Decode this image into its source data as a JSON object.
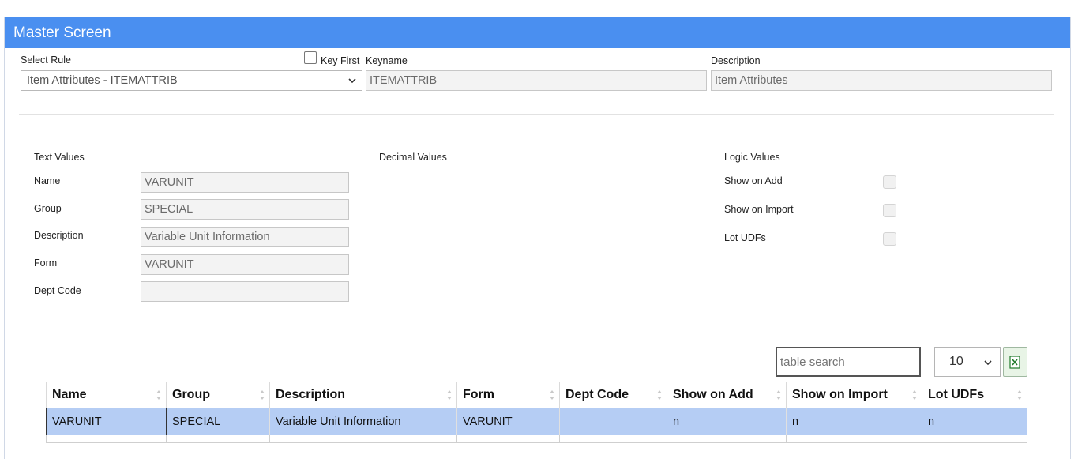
{
  "panel": {
    "title": "Master Screen"
  },
  "header": {
    "select_rule_label": "Select Rule",
    "select_rule_value": "Item Attributes - ITEMATTRIB",
    "key_first_label": "Key First",
    "keyname_label": "Keyname",
    "keyname_value": "ITEMATTRIB",
    "description_label": "Description",
    "description_value": "Item Attributes"
  },
  "text_values": {
    "heading": "Text Values",
    "fields": [
      {
        "label": "Name",
        "value": "VARUNIT"
      },
      {
        "label": "Group",
        "value": "SPECIAL"
      },
      {
        "label": "Description",
        "value": "Variable Unit Information"
      },
      {
        "label": "Form",
        "value": "VARUNIT"
      },
      {
        "label": "Dept Code",
        "value": ""
      }
    ]
  },
  "decimal_values": {
    "heading": "Decimal Values"
  },
  "logic_values": {
    "heading": "Logic Values",
    "fields": [
      {
        "label": "Show on Add"
      },
      {
        "label": "Show on Import"
      },
      {
        "label": "Lot UDFs"
      }
    ]
  },
  "table_tools": {
    "search_placeholder": "table search",
    "page_size": "10"
  },
  "table": {
    "columns": [
      "Name",
      "Group",
      "Description",
      "Form",
      "Dept Code",
      "Show on Add",
      "Show on Import",
      "Lot UDFs"
    ],
    "rows": [
      [
        "VARUNIT",
        "SPECIAL",
        "Variable Unit Information",
        "VARUNIT",
        "",
        "n",
        "n",
        "n"
      ]
    ]
  },
  "colors": {
    "header_bg": "#4a8ff0",
    "selected_row": "#b5cdf4",
    "excel_green": "#1f7a2a"
  }
}
